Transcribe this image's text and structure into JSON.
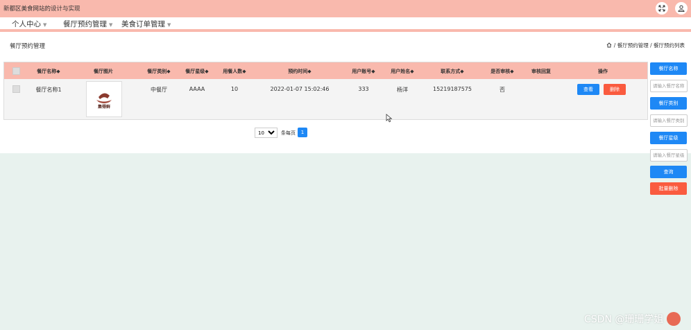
{
  "app": {
    "title": "新都区美食网站的设计与实现"
  },
  "nav": {
    "items": [
      {
        "label": "个人中心"
      },
      {
        "label": "餐厅预约管理"
      },
      {
        "label": "美食订单管理"
      }
    ]
  },
  "page": {
    "title": "餐厅预约管理",
    "breadcrumb": " / 餐厅预约管理 / 餐厅预约列表"
  },
  "table": {
    "headers": [
      "餐厅名称◆",
      "餐厅图片",
      "餐厅类别◆",
      "餐厅星级◆",
      "用餐人数◆",
      "预约时间◆",
      "用户账号◆",
      "用户姓名◆",
      "联系方式◆",
      "是否审核◆",
      "审核回复",
      "操作"
    ],
    "rows": [
      {
        "name": "餐厅名称1",
        "image_text": "集得鲜",
        "category": "中餐厅",
        "stars": "AAAA",
        "people": "10",
        "time": "2022-01-07 15:02:46",
        "account": "333",
        "username": "杨洋",
        "phone": "15219187575",
        "reviewed": "否",
        "reply": "",
        "view_label": "查看",
        "delete_label": "删除"
      }
    ]
  },
  "pagination": {
    "page_size": "10",
    "per_page_label": "条每页",
    "current_page": "1"
  },
  "sidebar": {
    "name_label": "餐厅名称",
    "name_placeholder": "请输入餐厅名称",
    "category_label": "餐厅类别",
    "category_placeholder": "请输入餐厅类别",
    "stars_label": "餐厅星级",
    "stars_placeholder": "请输入餐厅星级",
    "query_label": "查询",
    "batch_delete_label": "批量删除"
  },
  "watermark": "CSDN @珊珊学姐",
  "colors": {
    "header_bg": "#f9b9ad",
    "primary": "#1e88f5",
    "danger": "#fa5b3f",
    "page_bg": "#e8f2ee"
  },
  "icons": [
    "expand-icon",
    "user-icon",
    "home-icon",
    "chevron-down-icon",
    "mouse-cursor-icon"
  ]
}
